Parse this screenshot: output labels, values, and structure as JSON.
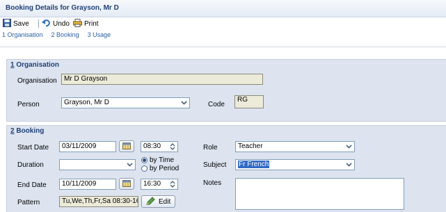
{
  "window": {
    "title": "Booking Details for Grayson, Mr D"
  },
  "toolbar": {
    "save_label": "Save",
    "undo_label": "Undo",
    "print_label": "Print"
  },
  "tabs": [
    {
      "label": "1 Organisation"
    },
    {
      "label": "2 Booking"
    },
    {
      "label": "3 Usage"
    }
  ],
  "organisation": {
    "section_num": "1",
    "section_title": " Organisation",
    "organisation_label": "Organisation",
    "organisation_value": "Mr D Grayson",
    "person_label": "Person",
    "person_value": "Grayson, Mr D",
    "code_label": "Code",
    "code_value": "RG"
  },
  "booking": {
    "section_num": "2",
    "section_title": " Booking",
    "start_date_label": "Start Date",
    "start_date_value": "03/11/2009",
    "start_time_value": "08:30",
    "duration_label": "Duration",
    "duration_value": "",
    "by_time_label": "by Time",
    "by_period_label": "by Period",
    "by_time_selected": true,
    "end_date_label": "End Date",
    "end_date_value": "10/11/2009",
    "end_time_value": "16:30",
    "pattern_label": "Pattern",
    "pattern_value": "Tu,We,Th,Fr,Sa 08:30-16",
    "edit_label": "Edit",
    "role_label": "Role",
    "role_value": "Teacher",
    "subject_label": "Subject",
    "subject_value": "Fr French",
    "notes_label": "Notes",
    "notes_value": ""
  },
  "colors": {
    "accent": "#1f3f7a",
    "panel": "#dde4ef",
    "selection": "#316ac5"
  }
}
